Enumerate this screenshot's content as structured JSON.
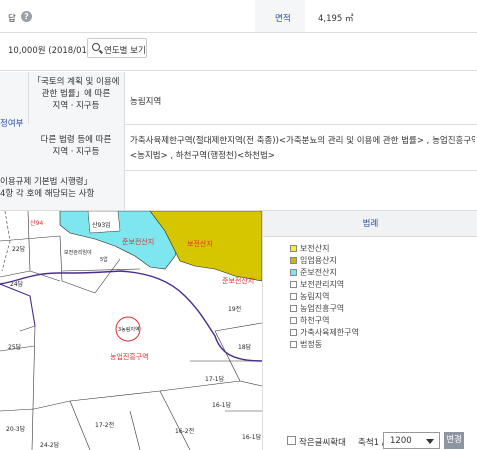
{
  "row1": {
    "jimok_value": "답",
    "help_icon": "?",
    "area_label": "면적",
    "area_value": "4,195 ㎡"
  },
  "row2": {
    "price_value": "10,000원 (2018/01)",
    "year_button": "연도별 보기"
  },
  "zoning": {
    "section_label": "정여부",
    "header1": "「국토의 계획 및 이용에 관한 법률」에 따른 지역ㆍ지구등",
    "header1_lines": [
      "「국토의 계획 및 이용에",
      "관한 법률」에 따른",
      "지역ㆍ지구등"
    ],
    "value1": "농림지역",
    "header2_lines": [
      "다른 법령 등에 따른",
      "지역ㆍ지구등"
    ],
    "value2_lines": [
      "가축사육제한구역(절대제한지역(전 축종))<가축분뇨의 관리 및 이용에 관한 법률> , 농업진흥구역(",
      "<농지법> , 하천구역(행정천)<하천법>"
    ],
    "header3_lines": [
      "이용규제 기본법 시행령」",
      "4항 각 호에 해당되는 사항"
    ]
  },
  "map": {
    "labels": {
      "l1": "22답",
      "l2": "산93임",
      "l3": "보전관리임야",
      "l4": "5업",
      "l5": "24답",
      "l6": "산94",
      "l7": "준보전산지",
      "l8": "보전산지",
      "l9": "준보전산지",
      "l10": "19전",
      "l11": "18답",
      "l12": "25답",
      "l13": "3농림지역",
      "l14": "농업진흥구역",
      "l15": "17-1답",
      "l16": "16-1답",
      "l17": "20-3답",
      "l18": "17-2전",
      "l19": "16-2전",
      "l20": "16-1답",
      "l21": "24-2답"
    }
  },
  "legend": {
    "title": "범례",
    "items": [
      {
        "label": "보전산지",
        "color": "#f4ef2a"
      },
      {
        "label": "임업용산지",
        "color": "#c9b700"
      },
      {
        "label": "준보전산지",
        "color": "#7ee6ee"
      },
      {
        "label": "보전관리지역",
        "color": "#ffffff"
      },
      {
        "label": "농림지역",
        "color": "#ffffff"
      },
      {
        "label": "농업진흥구역",
        "color": "#ffffff"
      },
      {
        "label": "하천구역",
        "color": "#ffffff"
      },
      {
        "label": "가축사육제한구역",
        "color": "#ffffff"
      },
      {
        "label": "법정동",
        "color": "#ffffff"
      }
    ],
    "enlarge_checkbox": "작은글씨확대",
    "scale_label": "축척1 /",
    "scale_value": "1200",
    "change_button": "변경"
  },
  "colors": {
    "accent": "#2b4fa3",
    "boundary": "#4a2b8f",
    "highlight_red": "#e03030"
  }
}
